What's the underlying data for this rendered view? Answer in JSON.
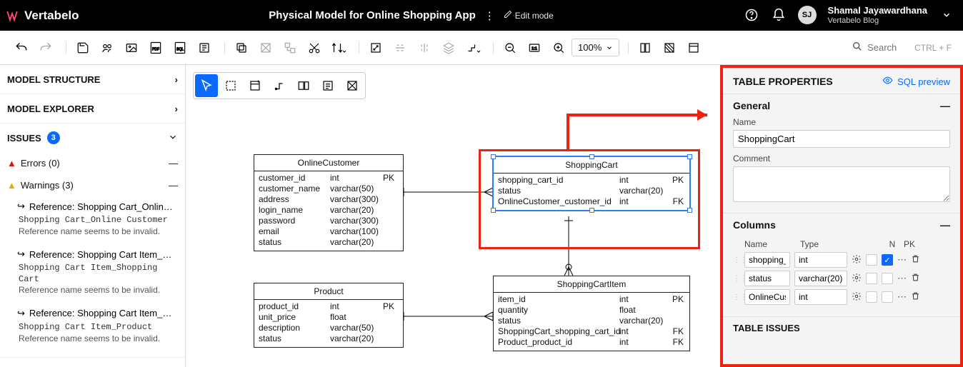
{
  "header": {
    "app_name": "Vertabelo",
    "model_title": "Physical Model for Online Shopping App",
    "edit_mode": "Edit mode",
    "user_initials": "SJ",
    "user_name": "Shamal Jayawardhana",
    "user_sub": "Vertabelo Blog"
  },
  "toolbar": {
    "zoom_pct": "100%"
  },
  "search": {
    "placeholder": "Search",
    "kbd": "CTRL + F"
  },
  "left": {
    "model_structure": "MODEL STRUCTURE",
    "model_explorer": "MODEL EXPLORER",
    "issues_label": "ISSUES",
    "issues_count": "3",
    "errors_label": "Errors (0)",
    "warnings_label": "Warnings (3)",
    "warnings": [
      {
        "title": "Reference: Shopping Cart_Online Cus...",
        "msg1": "Shopping Cart_Online Customer",
        "msg2": "Reference name seems to be invalid."
      },
      {
        "title": "Reference: Shopping Cart Item_Shopp...",
        "msg1": "Shopping Cart Item_Shopping Cart",
        "msg2": "Reference name seems to be invalid."
      },
      {
        "title": "Reference: Shopping Cart Item_Product",
        "msg1": "Shopping Cart Item_Product",
        "msg2": "Reference name seems to be invalid."
      }
    ]
  },
  "tables": {
    "online_customer": {
      "name": "OnlineCustomer",
      "cols": [
        {
          "n": "customer_id",
          "t": "int",
          "k": "PK"
        },
        {
          "n": "customer_name",
          "t": "varchar(50)",
          "k": ""
        },
        {
          "n": "address",
          "t": "varchar(300)",
          "k": ""
        },
        {
          "n": "login_name",
          "t": "varchar(20)",
          "k": ""
        },
        {
          "n": "password",
          "t": "varchar(300)",
          "k": ""
        },
        {
          "n": "email",
          "t": "varchar(100)",
          "k": ""
        },
        {
          "n": "status",
          "t": "varchar(20)",
          "k": ""
        }
      ]
    },
    "shopping_cart": {
      "name": "ShoppingCart",
      "cols": [
        {
          "n": "shopping_cart_id",
          "t": "int",
          "k": "PK"
        },
        {
          "n": "status",
          "t": "varchar(20)",
          "k": ""
        },
        {
          "n": "OnlineCustomer_customer_id",
          "t": "int",
          "k": "FK"
        }
      ]
    },
    "product": {
      "name": "Product",
      "cols": [
        {
          "n": "product_id",
          "t": "int",
          "k": "PK"
        },
        {
          "n": "unit_price",
          "t": "float",
          "k": ""
        },
        {
          "n": "description",
          "t": "varchar(50)",
          "k": ""
        },
        {
          "n": "status",
          "t": "varchar(20)",
          "k": ""
        }
      ]
    },
    "shopping_cart_item": {
      "name": "ShoppingCartItem",
      "cols": [
        {
          "n": "item_id",
          "t": "int",
          "k": "PK"
        },
        {
          "n": "quantity",
          "t": "float",
          "k": ""
        },
        {
          "n": "status",
          "t": "varchar(20)",
          "k": ""
        },
        {
          "n": "ShoppingCart_shopping_cart_id",
          "t": "int",
          "k": "FK"
        },
        {
          "n": "Product_product_id",
          "t": "int",
          "k": "FK"
        }
      ]
    }
  },
  "props": {
    "title": "TABLE PROPERTIES",
    "sql_preview": "SQL preview",
    "general": "General",
    "name_label": "Name",
    "name_value": "ShoppingCart",
    "comment_label": "Comment",
    "comment_value": "",
    "columns": "Columns",
    "col_hdr_name": "Name",
    "col_hdr_type": "Type",
    "col_hdr_n": "N",
    "col_hdr_pk": "PK",
    "rows": [
      {
        "name": "shopping_",
        "type": "int",
        "pk": true
      },
      {
        "name": "status",
        "type": "varchar(20)",
        "pk": false
      },
      {
        "name": "OnlineCus",
        "type": "int",
        "pk": false
      }
    ],
    "table_issues": "TABLE ISSUES"
  }
}
